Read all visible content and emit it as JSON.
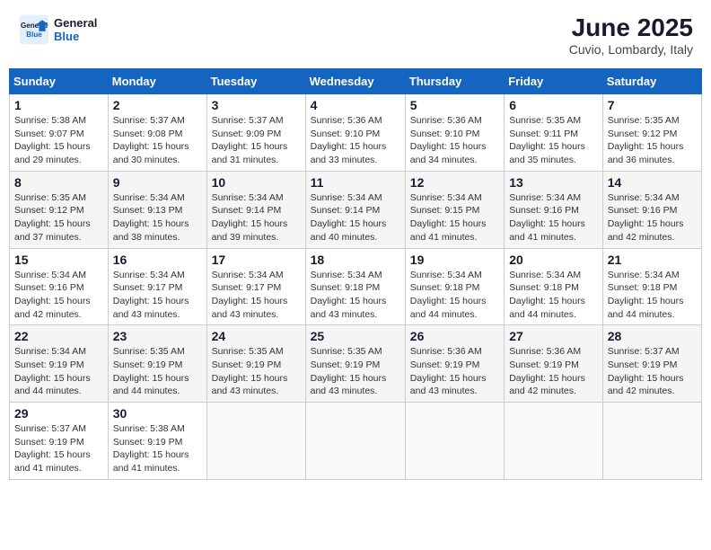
{
  "header": {
    "logo_line1": "General",
    "logo_line2": "Blue",
    "month_year": "June 2025",
    "location": "Cuvio, Lombardy, Italy"
  },
  "days_of_week": [
    "Sunday",
    "Monday",
    "Tuesday",
    "Wednesday",
    "Thursday",
    "Friday",
    "Saturday"
  ],
  "weeks": [
    [
      {
        "day": "1",
        "sunrise": "5:38 AM",
        "sunset": "9:07 PM",
        "daylight": "15 hours and 29 minutes."
      },
      {
        "day": "2",
        "sunrise": "5:37 AM",
        "sunset": "9:08 PM",
        "daylight": "15 hours and 30 minutes."
      },
      {
        "day": "3",
        "sunrise": "5:37 AM",
        "sunset": "9:09 PM",
        "daylight": "15 hours and 31 minutes."
      },
      {
        "day": "4",
        "sunrise": "5:36 AM",
        "sunset": "9:10 PM",
        "daylight": "15 hours and 33 minutes."
      },
      {
        "day": "5",
        "sunrise": "5:36 AM",
        "sunset": "9:10 PM",
        "daylight": "15 hours and 34 minutes."
      },
      {
        "day": "6",
        "sunrise": "5:35 AM",
        "sunset": "9:11 PM",
        "daylight": "15 hours and 35 minutes."
      },
      {
        "day": "7",
        "sunrise": "5:35 AM",
        "sunset": "9:12 PM",
        "daylight": "15 hours and 36 minutes."
      }
    ],
    [
      {
        "day": "8",
        "sunrise": "5:35 AM",
        "sunset": "9:12 PM",
        "daylight": "15 hours and 37 minutes."
      },
      {
        "day": "9",
        "sunrise": "5:34 AM",
        "sunset": "9:13 PM",
        "daylight": "15 hours and 38 minutes."
      },
      {
        "day": "10",
        "sunrise": "5:34 AM",
        "sunset": "9:14 PM",
        "daylight": "15 hours and 39 minutes."
      },
      {
        "day": "11",
        "sunrise": "5:34 AM",
        "sunset": "9:14 PM",
        "daylight": "15 hours and 40 minutes."
      },
      {
        "day": "12",
        "sunrise": "5:34 AM",
        "sunset": "9:15 PM",
        "daylight": "15 hours and 41 minutes."
      },
      {
        "day": "13",
        "sunrise": "5:34 AM",
        "sunset": "9:16 PM",
        "daylight": "15 hours and 41 minutes."
      },
      {
        "day": "14",
        "sunrise": "5:34 AM",
        "sunset": "9:16 PM",
        "daylight": "15 hours and 42 minutes."
      }
    ],
    [
      {
        "day": "15",
        "sunrise": "5:34 AM",
        "sunset": "9:16 PM",
        "daylight": "15 hours and 42 minutes."
      },
      {
        "day": "16",
        "sunrise": "5:34 AM",
        "sunset": "9:17 PM",
        "daylight": "15 hours and 43 minutes."
      },
      {
        "day": "17",
        "sunrise": "5:34 AM",
        "sunset": "9:17 PM",
        "daylight": "15 hours and 43 minutes."
      },
      {
        "day": "18",
        "sunrise": "5:34 AM",
        "sunset": "9:18 PM",
        "daylight": "15 hours and 43 minutes."
      },
      {
        "day": "19",
        "sunrise": "5:34 AM",
        "sunset": "9:18 PM",
        "daylight": "15 hours and 44 minutes."
      },
      {
        "day": "20",
        "sunrise": "5:34 AM",
        "sunset": "9:18 PM",
        "daylight": "15 hours and 44 minutes."
      },
      {
        "day": "21",
        "sunrise": "5:34 AM",
        "sunset": "9:18 PM",
        "daylight": "15 hours and 44 minutes."
      }
    ],
    [
      {
        "day": "22",
        "sunrise": "5:34 AM",
        "sunset": "9:19 PM",
        "daylight": "15 hours and 44 minutes."
      },
      {
        "day": "23",
        "sunrise": "5:35 AM",
        "sunset": "9:19 PM",
        "daylight": "15 hours and 44 minutes."
      },
      {
        "day": "24",
        "sunrise": "5:35 AM",
        "sunset": "9:19 PM",
        "daylight": "15 hours and 43 minutes."
      },
      {
        "day": "25",
        "sunrise": "5:35 AM",
        "sunset": "9:19 PM",
        "daylight": "15 hours and 43 minutes."
      },
      {
        "day": "26",
        "sunrise": "5:36 AM",
        "sunset": "9:19 PM",
        "daylight": "15 hours and 43 minutes."
      },
      {
        "day": "27",
        "sunrise": "5:36 AM",
        "sunset": "9:19 PM",
        "daylight": "15 hours and 42 minutes."
      },
      {
        "day": "28",
        "sunrise": "5:37 AM",
        "sunset": "9:19 PM",
        "daylight": "15 hours and 42 minutes."
      }
    ],
    [
      {
        "day": "29",
        "sunrise": "5:37 AM",
        "sunset": "9:19 PM",
        "daylight": "15 hours and 41 minutes."
      },
      {
        "day": "30",
        "sunrise": "5:38 AM",
        "sunset": "9:19 PM",
        "daylight": "15 hours and 41 minutes."
      },
      null,
      null,
      null,
      null,
      null
    ]
  ]
}
